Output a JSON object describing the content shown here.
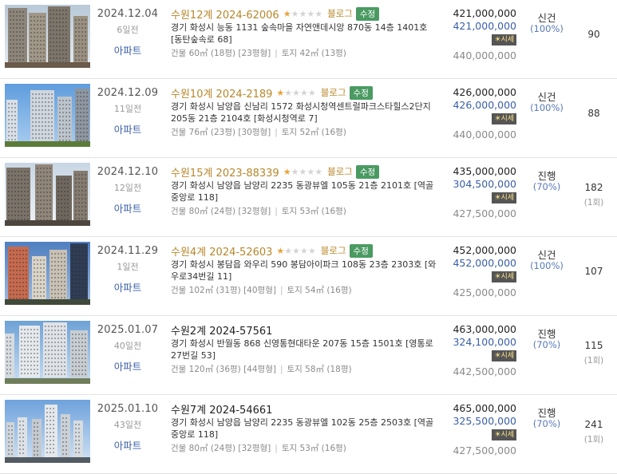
{
  "listings": [
    {
      "date": "2024.12.04",
      "days_ago": "6일전",
      "type": "아파트",
      "case_title": "수원12계 2024-62006",
      "rating": 1,
      "blog": "블로그",
      "badge": "수정",
      "address": "경기 화성시 능동 1131 숲속마을 자연앤데시앙 870동 14층 1401호 [동탄숲속로 68]",
      "building_area": "건물 60㎡ (18평) [23평형]",
      "land_area": "토지 42㎡ (13평)",
      "appraisal_price": "421,000,000",
      "min_price": "421,000,000",
      "market_label": "시세",
      "market_price": "440,000,000",
      "status": "신건",
      "percent": "(100%)",
      "views": "90",
      "fail_count": ""
    },
    {
      "date": "2024.12.09",
      "days_ago": "11일전",
      "type": "아파트",
      "case_title": "수원10계 2024-2189",
      "rating": 1,
      "blog": "블로그",
      "badge": "수정",
      "address": "경기 화성시 남양읍 신남리 1572 화성시청역센트럴파크스타힐스2단지 205동 21층 2104호 [화성시청역로 7]",
      "building_area": "건물 76㎡ (23평) [30평형]",
      "land_area": "토지 52㎡ (16평)",
      "appraisal_price": "426,000,000",
      "min_price": "426,000,000",
      "market_label": "시세",
      "market_price": "440,000,000",
      "status": "신건",
      "percent": "(100%)",
      "views": "88",
      "fail_count": ""
    },
    {
      "date": "2024.12.10",
      "days_ago": "12일전",
      "type": "아파트",
      "case_title": "수원15계 2023-88339",
      "rating": 1,
      "blog": "블로그",
      "badge": "수정",
      "address": "경기 화성시 남양읍 남양리 2235 동광뷰엘 105동 21층 2101호 [역골중앙로 118]",
      "building_area": "건물 80㎡ (24평) [32평형]",
      "land_area": "토지 53㎡ (16평)",
      "appraisal_price": "435,000,000",
      "min_price": "304,500,000",
      "market_label": "시세",
      "market_price": "427,500,000",
      "status": "진행",
      "percent": "(70%)",
      "views": "182",
      "fail_count": "(1회)"
    },
    {
      "date": "2024.11.29",
      "days_ago": "1일전",
      "type": "아파트",
      "case_title": "수원4계 2024-52603",
      "rating": 1,
      "blog": "블로그",
      "badge": "수정",
      "address": "경기 화성시 봉담읍 와우리 590 봉담아이파크 108동 23층 2303호 [와우로34번길 11]",
      "building_area": "건물 102㎡ (31평) [40평형]",
      "land_area": "토지 54㎡ (16평)",
      "appraisal_price": "452,000,000",
      "min_price": "452,000,000",
      "market_label": "시세",
      "market_price": "425,000,000",
      "status": "신건",
      "percent": "(100%)",
      "views": "107",
      "fail_count": ""
    },
    {
      "date": "2025.01.07",
      "days_ago": "40일전",
      "type": "아파트",
      "case_title": "수원2계 2024-57561",
      "rating": 0,
      "blog": "",
      "badge": "",
      "address": "경기 화성시 반월동 868 신영통현대타운 207동 15층 1501호 [영통로27번길 53]",
      "building_area": "건물 120㎡ (36평) [44평형]",
      "land_area": "토지 58㎡ (18평)",
      "appraisal_price": "463,000,000",
      "min_price": "324,100,000",
      "market_label": "시세",
      "market_price": "442,500,000",
      "status": "진행",
      "percent": "(70%)",
      "views": "115",
      "fail_count": "(1회)"
    },
    {
      "date": "2025.01.10",
      "days_ago": "43일전",
      "type": "아파트",
      "case_title": "수원7계 2024-54661",
      "rating": 0,
      "blog": "",
      "badge": "",
      "address": "경기 화성시 남양읍 남양리 2235 동광뷰엘 102동 25층 2503호 [역골중앙로 118]",
      "building_area": "건물 80㎡ (24평) [32평형]",
      "land_area": "토지 53㎡ (16평)",
      "appraisal_price": "465,000,000",
      "min_price": "325,500,000",
      "market_label": "시세",
      "market_price": "427,500,000",
      "status": "진행",
      "percent": "(70%)",
      "views": "241",
      "fail_count": "(1회)"
    }
  ],
  "colors": {
    "case_title": "#b8872a",
    "min_price": "#3a5ea8",
    "badge": "#4a9a62",
    "star_on": "#e8a33a",
    "market_button": "#555555"
  },
  "icons": {
    "star": "star-icon",
    "market": "sun-icon"
  }
}
